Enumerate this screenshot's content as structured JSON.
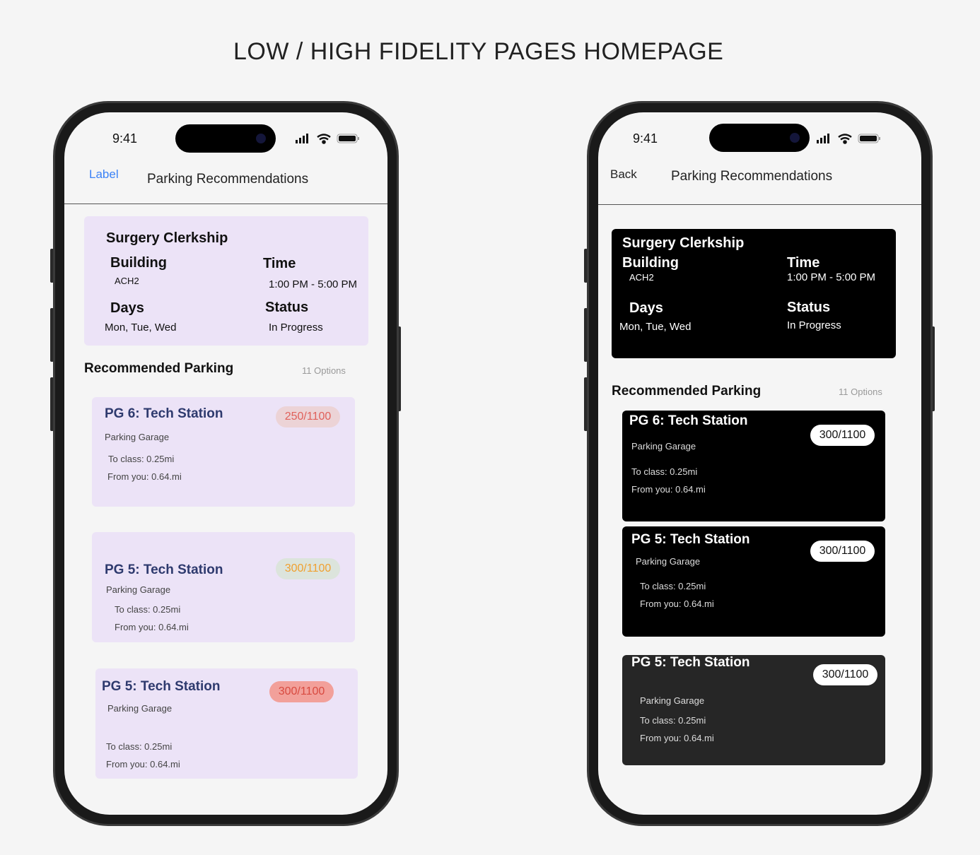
{
  "page_title": "LOW / HIGH FIDELITY PAGES HOMEPAGE",
  "low_fi": {
    "status_time": "9:41",
    "nav_left": "Label",
    "nav_title": "Parking Recommendations",
    "info": {
      "course": "Surgery Clerkship",
      "building_label": "Building",
      "building": "ACH2",
      "time_label": "Time",
      "time": "1:00 PM - 5:00 PM",
      "days_label": "Days",
      "days": "Mon, Tue, Wed",
      "status_label": "Status",
      "status": "In Progress"
    },
    "section_title": "Recommended Parking",
    "options_count": "11 Options",
    "cards": [
      {
        "title": "PG 6: Tech Station",
        "type": "Parking Garage",
        "to_class": "To class:  0.25mi",
        "from_you": "From you: 0.64.mi",
        "capacity": "250/1100",
        "badge_bg": "#ecd3d6",
        "badge_fg": "#e0605a"
      },
      {
        "title": "PG 5: Tech Station",
        "type": "Parking Garage",
        "to_class": "To class:  0.25mi",
        "from_you": "From you: 0.64.mi",
        "capacity": "300/1100",
        "badge_bg": "#dce4dc",
        "badge_fg": "#f0a030"
      },
      {
        "title": "PG 5: Tech Station",
        "type": "Parking Garage",
        "to_class": "To class:  0.25mi",
        "from_you": "From you: 0.64.mi",
        "capacity": "300/1100",
        "badge_bg": "#f2a09a",
        "badge_fg": "#d84a40"
      }
    ]
  },
  "high_fi": {
    "status_time": "9:41",
    "nav_left": "Back",
    "nav_title": "Parking Recommendations",
    "info": {
      "course": "Surgery Clerkship",
      "building_label": "Building",
      "building": "ACH2",
      "time_label": "Time",
      "time": "1:00 PM - 5:00 PM",
      "days_label": "Days",
      "days": "Mon, Tue, Wed",
      "status_label": "Status",
      "status": "In Progress"
    },
    "section_title": "Recommended Parking",
    "options_count": "11 Options",
    "cards": [
      {
        "title": "PG 6: Tech Station",
        "type": "Parking Garage",
        "to_class": "To class:  0.25mi",
        "from_you": "From you: 0.64.mi",
        "capacity": "300/1100"
      },
      {
        "title": "PG 5: Tech Station",
        "type": "Parking Garage",
        "to_class": "To class:  0.25mi",
        "from_you": "From you: 0.64.mi",
        "capacity": "300/1100"
      },
      {
        "title": "PG 5: Tech Station",
        "type": "Parking Garage",
        "to_class": "To class:  0.25mi",
        "from_you": "From you: 0.64.mi",
        "capacity": "300/1100"
      }
    ]
  },
  "colors": {
    "accent_link": "#3b82f6",
    "card_lavender": "#ece3f7",
    "card_title": "#2e3a6e"
  }
}
